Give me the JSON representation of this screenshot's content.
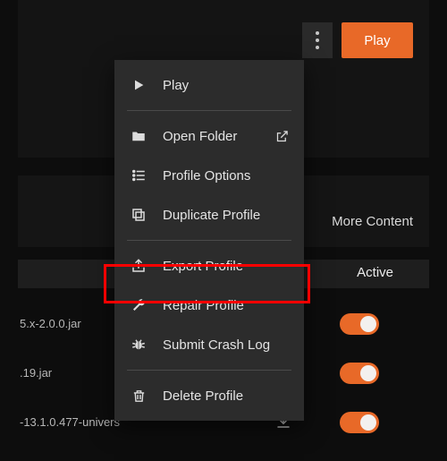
{
  "header": {
    "play_label": "Play"
  },
  "tabs": {
    "more_content": "More Content"
  },
  "columns": {
    "active_label": "Active"
  },
  "menu": {
    "play": "Play",
    "open_folder": "Open Folder",
    "profile_options": "Profile Options",
    "duplicate_profile": "Duplicate Profile",
    "export_profile": "Export Profile",
    "repair_profile": "Repair Profile",
    "submit_crash_log": "Submit Crash Log",
    "delete_profile": "Delete Profile"
  },
  "files": {
    "row1": "5.x-2.0.0.jar",
    "row2": ".19.jar",
    "row3": "-13.1.0.477-univers"
  }
}
